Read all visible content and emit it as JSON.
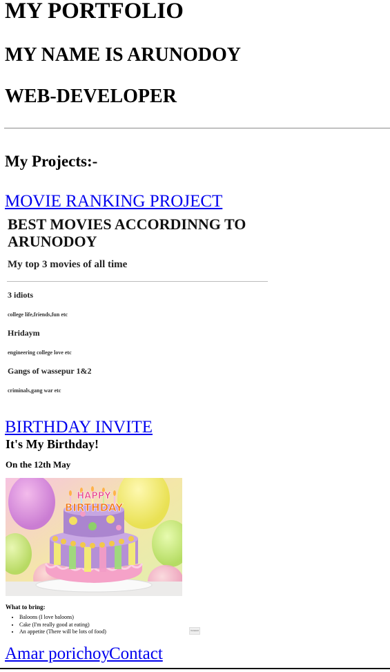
{
  "header": {
    "title": "MY PORTFOLIO",
    "name_line": "MY NAME IS ARUNODOY",
    "role_line": "WEB-DEVELOPER"
  },
  "projects": {
    "heading": "My Projects:-",
    "movie": {
      "link_label": "MOVIE RANKING PROJECT",
      "preview": {
        "title": "BEST MOVIES ACCORDINNG TO ARUNODOY",
        "subtitle": "My top 3 movies of all time",
        "movies": [
          {
            "name": "3 idiots",
            "desc": "college life,friends,fun etc"
          },
          {
            "name": "Hridaym",
            "desc": "engineering college love etc"
          },
          {
            "name": "Gangs of wassepur 1&2",
            "desc": "criminals,gang war etc"
          }
        ]
      }
    },
    "birthday": {
      "link_label": "BIRTHDAY INVITE",
      "preview": {
        "title": "It's My Birthday!",
        "date": "On the 12th May",
        "bring_heading": "What to bring:",
        "items": [
          "Baloons (I love baloons)",
          "Cake (I'm really good at eating)",
          "An appetite (There will be lots of food)"
        ],
        "button_label": "Forward",
        "cake_topper_line1": "HAPPY",
        "cake_topper_line2": "BIRTHDAY"
      }
    }
  },
  "footer": {
    "about_link": "Amar porichoy",
    "contact_link": "Contact"
  },
  "colors": {
    "link": "#0000ee",
    "rule": "#8a8a8a"
  }
}
